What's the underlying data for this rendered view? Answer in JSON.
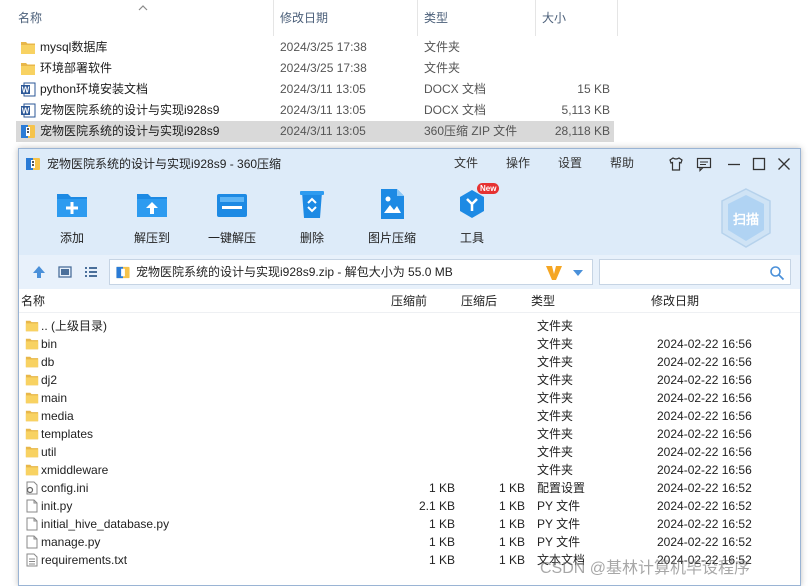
{
  "explorer": {
    "columns": {
      "name": "名称",
      "modified": "修改日期",
      "type": "类型",
      "size": "大小"
    },
    "rows": [
      {
        "name": "mysql数据库",
        "modified": "2024/3/25 17:38",
        "type": "文件夹",
        "size": "",
        "icon": "folder-icon",
        "selected": false
      },
      {
        "name": "环境部署软件",
        "modified": "2024/3/25 17:38",
        "type": "文件夹",
        "size": "",
        "icon": "folder-icon",
        "selected": false
      },
      {
        "name": "python环境安装文档",
        "modified": "2024/3/11 13:05",
        "type": "DOCX 文档",
        "size": "15 KB",
        "icon": "word-doc-icon",
        "selected": false
      },
      {
        "name": "宠物医院系统的设计与实现i928s9",
        "modified": "2024/3/11 13:05",
        "type": "DOCX 文档",
        "size": "5,113 KB",
        "icon": "word-doc-icon",
        "selected": false
      },
      {
        "name": "宠物医院系统的设计与实现i928s9",
        "modified": "2024/3/11 13:05",
        "type": "360压缩 ZIP 文件",
        "size": "28,118 KB",
        "icon": "zip-archive-icon",
        "selected": true
      }
    ]
  },
  "window": {
    "title": "宠物医院系统的设计与实现i928s9 - 360压缩",
    "menu": [
      "文件",
      "操作",
      "设置",
      "帮助"
    ],
    "toolbar": [
      "添加",
      "解压到",
      "一键解压",
      "删除",
      "图片压缩",
      "工具"
    ],
    "new_badge": "New",
    "scan_label": "扫描",
    "address": "宠物医院系统的设计与实现i928s9.zip - 解包大小为 55.0 MB",
    "search_placeholder": "",
    "columns": {
      "name": "名称",
      "before": "压缩前",
      "after": "压缩后",
      "type": "类型",
      "modified": "修改日期"
    },
    "files": [
      {
        "name": ".. (上级目录)",
        "before": "",
        "after": "",
        "type": "文件夹",
        "modified": "",
        "icon": "folder-icon"
      },
      {
        "name": "bin",
        "before": "",
        "after": "",
        "type": "文件夹",
        "modified": "2024-02-22 16:56",
        "icon": "folder-icon"
      },
      {
        "name": "db",
        "before": "",
        "after": "",
        "type": "文件夹",
        "modified": "2024-02-22 16:56",
        "icon": "folder-icon"
      },
      {
        "name": "dj2",
        "before": "",
        "after": "",
        "type": "文件夹",
        "modified": "2024-02-22 16:56",
        "icon": "folder-icon"
      },
      {
        "name": "main",
        "before": "",
        "after": "",
        "type": "文件夹",
        "modified": "2024-02-22 16:56",
        "icon": "folder-icon"
      },
      {
        "name": "media",
        "before": "",
        "after": "",
        "type": "文件夹",
        "modified": "2024-02-22 16:56",
        "icon": "folder-icon"
      },
      {
        "name": "templates",
        "before": "",
        "after": "",
        "type": "文件夹",
        "modified": "2024-02-22 16:56",
        "icon": "folder-icon"
      },
      {
        "name": "util",
        "before": "",
        "after": "",
        "type": "文件夹",
        "modified": "2024-02-22 16:56",
        "icon": "folder-icon"
      },
      {
        "name": "xmiddleware",
        "before": "",
        "after": "",
        "type": "文件夹",
        "modified": "2024-02-22 16:56",
        "icon": "folder-icon"
      },
      {
        "name": "config.ini",
        "before": "1 KB",
        "after": "1 KB",
        "type": "配置设置",
        "modified": "2024-02-22 16:52",
        "icon": "settings-file-icon"
      },
      {
        "name": "init.py",
        "before": "2.1 KB",
        "after": "1 KB",
        "type": "PY 文件",
        "modified": "2024-02-22 16:52",
        "icon": "file-icon"
      },
      {
        "name": "initial_hive_database.py",
        "before": "1 KB",
        "after": "1 KB",
        "type": "PY 文件",
        "modified": "2024-02-22 16:52",
        "icon": "file-icon"
      },
      {
        "name": "manage.py",
        "before": "1 KB",
        "after": "1 KB",
        "type": "PY 文件",
        "modified": "2024-02-22 16:52",
        "icon": "file-icon"
      },
      {
        "name": "requirements.txt",
        "before": "1 KB",
        "after": "1 KB",
        "type": "文本文档",
        "modified": "2024-02-22 16:52",
        "icon": "text-file-icon"
      }
    ]
  },
  "watermark": "CSDN @基林计算机毕设程序",
  "colors": {
    "folder": "#f8d262",
    "toolbar_blue": "#1d8ae4",
    "word_blue": "#2b5797",
    "titlebar_bg": "#ddebf9",
    "selected_row": "#d9d9d9"
  }
}
